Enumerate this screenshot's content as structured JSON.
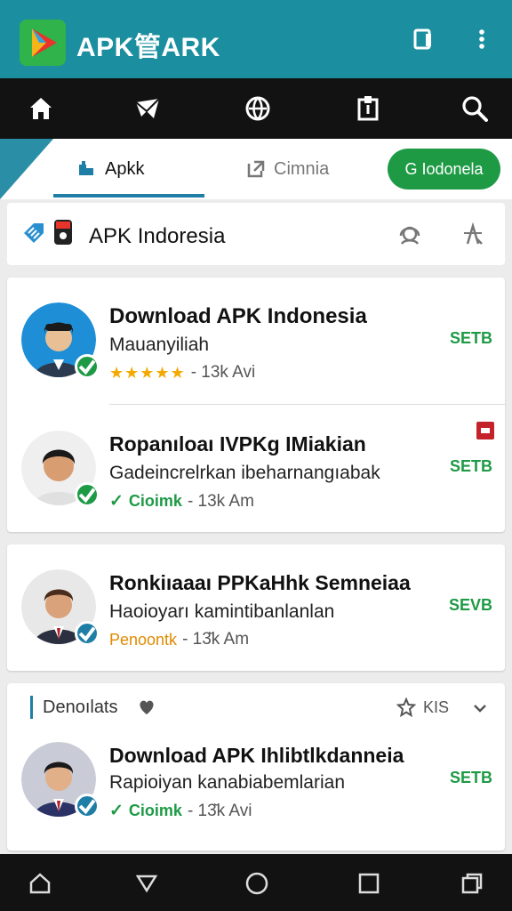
{
  "app": {
    "title": "APK管ARK",
    "accent_color": "#1b8f9f",
    "actions": [
      "tablet-icon",
      "more-vert-icon"
    ]
  },
  "nav": {
    "icons": [
      "home-icon",
      "mail-icon",
      "globe-icon",
      "clipboard-icon",
      "search-icon"
    ]
  },
  "tabs": {
    "items": [
      {
        "label": "Apkk",
        "icon": "puzzle-icon"
      },
      {
        "label": "Cimnia",
        "icon": "export-icon"
      }
    ],
    "pill_label": "G Iodonela",
    "pill_color": "#1e9a45"
  },
  "section": {
    "title": "APK Indoresia",
    "icons": [
      "tag-icon",
      "shield-icon",
      "headset-icon",
      "filter-icon"
    ]
  },
  "apps": [
    {
      "title": "Download APK Indonesia",
      "subtitle": "Mauanyiliah",
      "rating_stars": "★★★★★",
      "meta": "- 13k  Avi",
      "action": "SETB",
      "badge_color": "#1e9a45"
    },
    {
      "title": "Rорanıloaı IVPKg IMiakian",
      "subtitle": "Gadeincrelrkan ibeharnangıabak",
      "tag": "Cioimk",
      "meta": "- 13k  Am",
      "action": "SETB",
      "badge_color": "#1e9a45"
    },
    {
      "title": "Ronkiıaaaı PPKaHhk  Semneiaa",
      "subtitle": "Haoioyarı kamintibanlanlan",
      "tag": "Penoontk",
      "meta": "- 13̆k  Am",
      "action": "SEVB",
      "badge_color": "#1f7ea6"
    },
    {
      "title": "Download APK Ihlibtlkdanneia",
      "subtitle": "Rapioiyan kanabiabemlarian",
      "tag": "Cioimk",
      "meta": "- 13̆k  Avi",
      "action": "SETB",
      "badge_color": "#1f7ea6"
    }
  ],
  "subheader": {
    "label": "Denoılats",
    "right_text": "KIS"
  },
  "bottom": {
    "icons": [
      "home-outline-icon",
      "back-icon",
      "circle-icon",
      "square-icon",
      "recents-icon"
    ]
  }
}
